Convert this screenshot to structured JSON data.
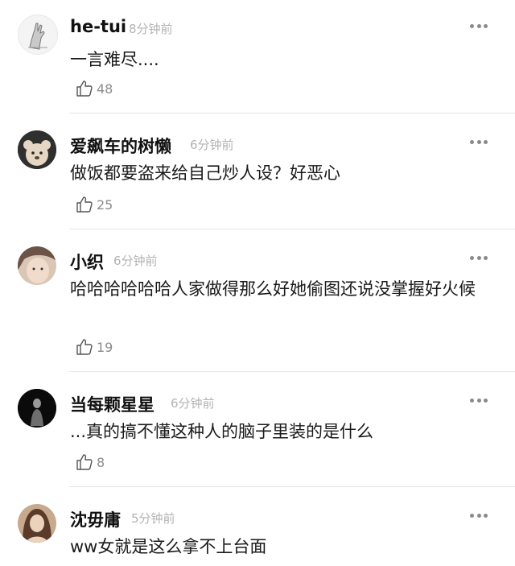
{
  "comments": [
    {
      "name": "he-tui",
      "time": "8分钟前",
      "text": "一言难尽....",
      "likes": "48"
    },
    {
      "name": "爱飙车的树懒",
      "time": "6分钟前",
      "text": "做饭都要盗来给自己炒人设？好恶心",
      "likes": "25"
    },
    {
      "name": "小织",
      "time": "6分钟前",
      "text": "哈哈哈哈哈哈人家做得那么好她偷图还说没掌握好火候",
      "likes": "19"
    },
    {
      "name": "当每颗星星",
      "time": "6分钟前",
      "text": "...真的搞不懂这种人的脑子里装的是什么",
      "likes": "8"
    },
    {
      "name": "沈毋庸",
      "time": "5分钟前",
      "text": "ww女就是这么拿不上台面",
      "likes": ""
    }
  ],
  "icons": {
    "like": "thumbs-up-icon",
    "more": "more-dots-icon"
  },
  "colors": {
    "text": "#1a1a1a",
    "meta": "#b3b3b3",
    "count": "#8c8c8c",
    "divider": "#e6e6e6"
  }
}
